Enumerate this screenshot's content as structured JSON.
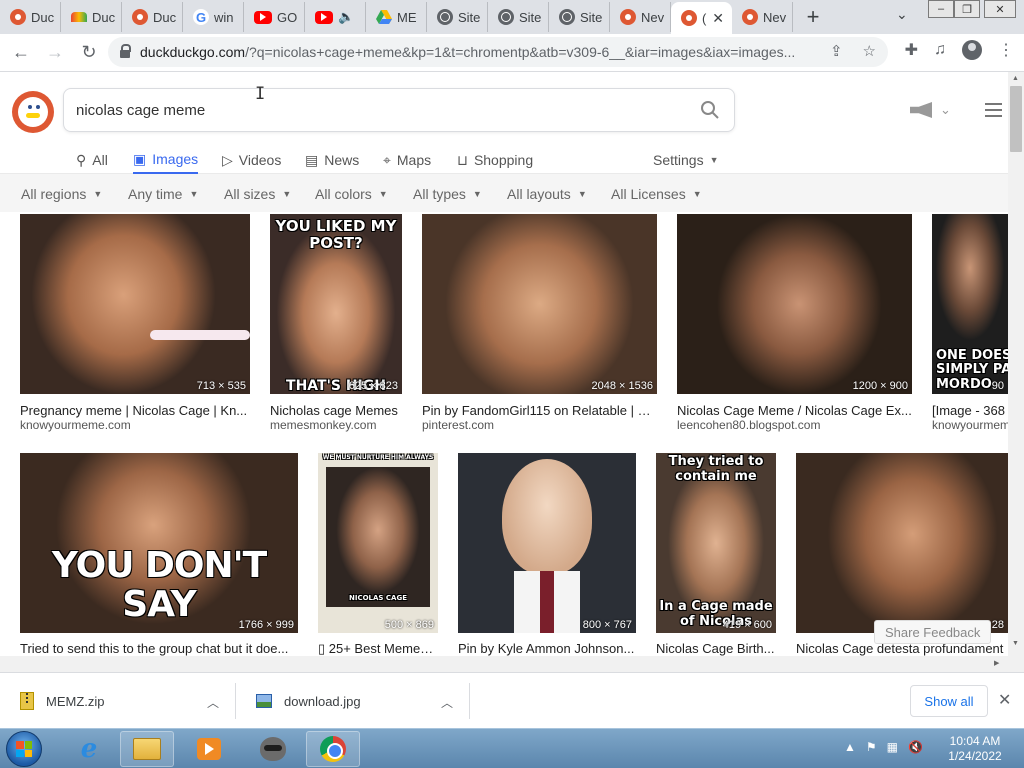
{
  "browser": {
    "tabs": [
      {
        "icon": "duckduckgo-icon",
        "label": "Duc"
      },
      {
        "icon": "rainbow-icon",
        "label": "Duc"
      },
      {
        "icon": "duckduckgo-icon",
        "label": "Duc"
      },
      {
        "icon": "google-icon",
        "label": "win"
      },
      {
        "icon": "youtube-icon",
        "label": "GO"
      },
      {
        "icon": "youtube-icon",
        "label": ""
      },
      {
        "icon": "drive-icon",
        "label": "ME"
      },
      {
        "icon": "globe-icon",
        "label": "Site"
      },
      {
        "icon": "globe-icon",
        "label": "Site"
      },
      {
        "icon": "globe-icon",
        "label": "Site"
      },
      {
        "icon": "duckduckgo-icon",
        "label": "Nev"
      },
      {
        "icon": "duckduckgo-icon",
        "label": "(",
        "active": true
      },
      {
        "icon": "duckduckgo-icon",
        "label": "Nev"
      }
    ],
    "url_host": "duckduckgo.com",
    "url_path": "/?q=nicolas+cage+meme&kp=1&t=chromentp&atb=v309-6__&iar=images&iax=images..."
  },
  "search": {
    "query": "nicolas cage meme"
  },
  "nav_tabs": [
    {
      "label": "All",
      "icon": "search-icon"
    },
    {
      "label": "Images",
      "icon": "image-icon",
      "active": true
    },
    {
      "label": "Videos",
      "icon": "play-icon"
    },
    {
      "label": "News",
      "icon": "news-icon"
    },
    {
      "label": "Maps",
      "icon": "map-pin-icon"
    },
    {
      "label": "Shopping",
      "icon": "bag-icon"
    }
  ],
  "settings_label": "Settings",
  "filters": [
    "All regions",
    "Any time",
    "All sizes",
    "All colors",
    "All types",
    "All layouts",
    "All Licenses"
  ],
  "results_row1": [
    {
      "dims": "713 × 535",
      "caption": "Pregnancy meme | Nicolas Cage | Kn...",
      "source": "knowyourmeme.com",
      "meme_top": "",
      "meme_bottom": ""
    },
    {
      "dims": "625 × 823",
      "caption": "Nicholas cage Memes",
      "source": "memesmonkey.com",
      "meme_top": "YOU LIKED MY POST?",
      "meme_bottom": "THAT'S HIGH"
    },
    {
      "dims": "2048 × 1536",
      "caption": "Pin by FandomGirl115 on Relatable | Ni...",
      "source": "pinterest.com",
      "meme_top": "",
      "meme_bottom": ""
    },
    {
      "dims": "1200 × 900",
      "caption": "Nicolas Cage Meme / Nicolas Cage Ex...",
      "source": "leencohen80.blogspot.com",
      "meme_top": "",
      "meme_bottom": ""
    },
    {
      "dims": "90",
      "caption": "[Image - 368",
      "source": "knowyourmem",
      "meme_top": "",
      "meme_bottom": "ONE DOES N SIMPLY PAY IN MORDO"
    }
  ],
  "results_row2": [
    {
      "dims": "1766 × 999",
      "caption": "Tried to send this to the group chat but it doe...",
      "meme_top": "",
      "meme_bottom": "YOU DON'T SAY"
    },
    {
      "dims": "500 × 869",
      "caption": "▯ 25+ Best Memes ...",
      "meme_top": "WE MUST NURTURE HIM ALWAYS",
      "meme_bottom": "NICOLAS CAGE"
    },
    {
      "dims": "800 × 767",
      "caption": "Pin by Kyle Ammon Johnson...",
      "meme_top": "",
      "meme_bottom": ""
    },
    {
      "dims": "419 × 600",
      "caption": "Nicolas Cage Birth...",
      "meme_top": "They tried to contain me",
      "meme_bottom": "In a Cage made of Nicolas"
    },
    {
      "dims": "28",
      "caption": "Nicolas Cage detesta profundament",
      "meme_top": "",
      "meme_bottom": ""
    }
  ],
  "share_feedback": "Share Feedback",
  "downloads": {
    "items": [
      {
        "name": "MEMZ.zip",
        "icon": "zip-icon"
      },
      {
        "name": "download.jpg",
        "icon": "image-file-icon"
      }
    ],
    "show_all": "Show all"
  },
  "taskbar": {
    "time": "10:04 AM",
    "date": "1/24/2022"
  }
}
